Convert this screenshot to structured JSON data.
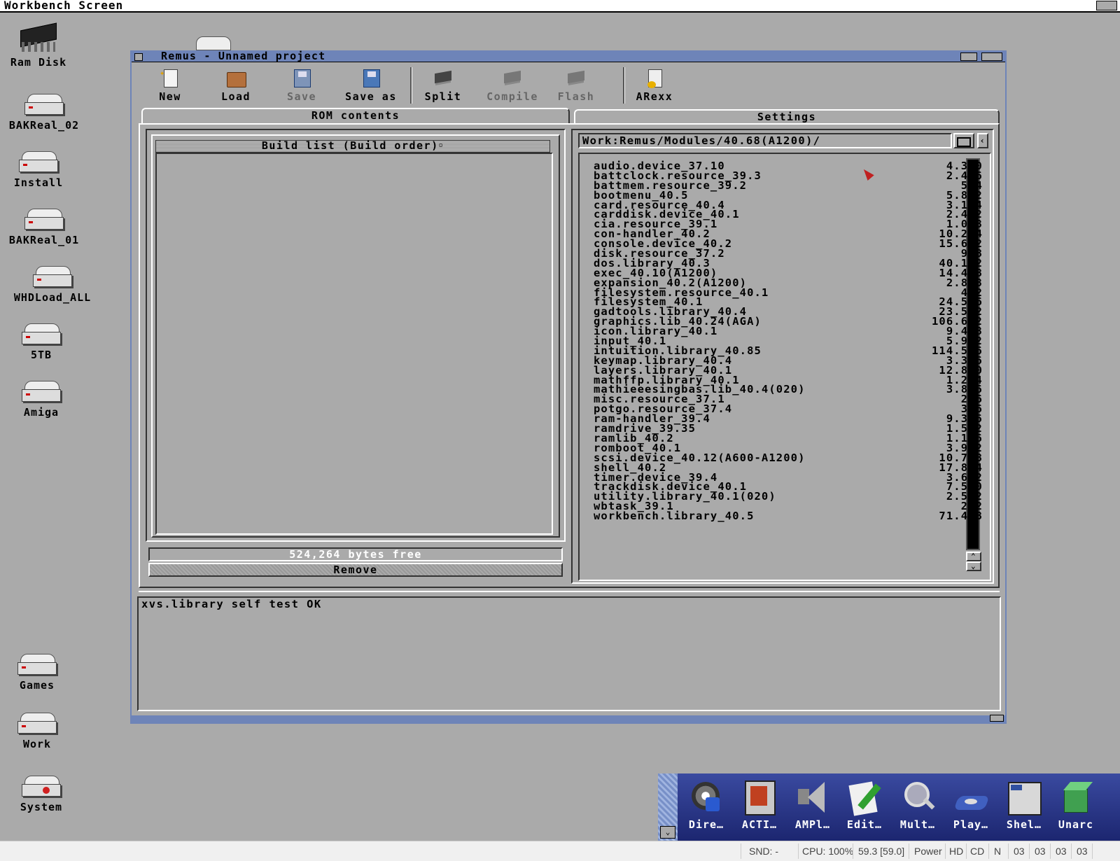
{
  "screen": {
    "title": "Workbench Screen"
  },
  "desktop_icons": [
    {
      "label": "Ram Disk",
      "type": "chip"
    },
    {
      "label": "BAKReal_02",
      "type": "drive"
    },
    {
      "label": "Install",
      "type": "drive"
    },
    {
      "label": "BAKReal_01",
      "type": "drive"
    },
    {
      "label": "WHDLoad_ALL",
      "type": "drive"
    },
    {
      "label": "5TB",
      "type": "drive"
    },
    {
      "label": "Amiga",
      "type": "drive"
    },
    {
      "label": "Games",
      "type": "drive"
    },
    {
      "label": "Work",
      "type": "drive"
    },
    {
      "label": "System",
      "type": "drive"
    }
  ],
  "window": {
    "title": "Remus - Unnamed project",
    "toolbar": {
      "new": "New",
      "load": "Load",
      "save": "Save",
      "save_as": "Save as",
      "split": "Split",
      "compile": "Compile",
      "flash": "Flash",
      "arexx": "ARexx"
    },
    "tabs": {
      "rom_contents": "ROM contents",
      "settings": "Settings"
    },
    "build_list": {
      "header": "Build list (Build order)",
      "bytes_free": "524,264 bytes free",
      "remove": "Remove"
    },
    "path": "Work:Remus/Modules/40.68(A1200)/",
    "modules": [
      {
        "name": "audio.device_37.10",
        "size": "4.360"
      },
      {
        "name": "battclock.resource_39.3",
        "size": "2.476"
      },
      {
        "name": "battmem.resource_39.2",
        "size": "544"
      },
      {
        "name": "bootmenu_40.5",
        "size": "5.812"
      },
      {
        "name": "card.resource_40.4",
        "size": "3.124"
      },
      {
        "name": "carddisk.device_40.1",
        "size": "2.432"
      },
      {
        "name": "cia.resource_39.1",
        "size": "1.068"
      },
      {
        "name": "con-handler_40.2",
        "size": "10.284"
      },
      {
        "name": "console.device_40.2",
        "size": "15.612"
      },
      {
        "name": "disk.resource_37.2",
        "size": "908"
      },
      {
        "name": "dos.library_40.3",
        "size": "40.132"
      },
      {
        "name": "exec_40.10(A1200)",
        "size": "14.428"
      },
      {
        "name": "expansion_40.2(A1200)",
        "size": "2.848"
      },
      {
        "name": "filesystem.resource_40.1",
        "size": "472"
      },
      {
        "name": "filesystem_40.1",
        "size": "24.536"
      },
      {
        "name": "gadtools.library_40.4",
        "size": "23.572"
      },
      {
        "name": "graphics.lib_40.24(AGA)",
        "size": "106.652"
      },
      {
        "name": "icon.library_40.1",
        "size": "9.448"
      },
      {
        "name": "input_40.1",
        "size": "5.932"
      },
      {
        "name": "intuition.library_40.85",
        "size": "114.536"
      },
      {
        "name": "keymap.library_40.4",
        "size": "3.376"
      },
      {
        "name": "layers.library_40.1",
        "size": "12.800"
      },
      {
        "name": "mathffp.library_40.1",
        "size": "1.244"
      },
      {
        "name": "mathieeesingbas.lib_40.4(020)",
        "size": "3.816"
      },
      {
        "name": "misc.resource_37.1",
        "size": "236"
      },
      {
        "name": "potgo.resource_37.4",
        "size": "376"
      },
      {
        "name": "ram-handler_39.4",
        "size": "9.396"
      },
      {
        "name": "ramdrive_39.35",
        "size": "1.592"
      },
      {
        "name": "ramlib_40.2",
        "size": "1.116"
      },
      {
        "name": "romboot_40.1",
        "size": "3.932"
      },
      {
        "name": "scsi.device_40.12(A600-A1200)",
        "size": "10.708"
      },
      {
        "name": "shell_40.2",
        "size": "17.844"
      },
      {
        "name": "timer.device_39.4",
        "size": "3.692"
      },
      {
        "name": "trackdisk.device_40.1",
        "size": "7.520"
      },
      {
        "name": "utility.library_40.1(020)",
        "size": "2.552"
      },
      {
        "name": "wbtask_39.1",
        "size": "252"
      },
      {
        "name": "workbench.library_40.5",
        "size": "71.408"
      }
    ],
    "log": "xvs.library self test OK"
  },
  "dock": {
    "items": [
      {
        "label": "Dire…",
        "icon": "directory-opus-icon",
        "color": "#c8c8d8"
      },
      {
        "label": "ACTI…",
        "icon": "activity-icon",
        "color": "#d0a040"
      },
      {
        "label": "AMPl…",
        "icon": "speaker-icon",
        "color": "#b0b0c0"
      },
      {
        "label": "Edit…",
        "icon": "pencil-icon",
        "color": "#40a040"
      },
      {
        "label": "Mult…",
        "icon": "magnifier-icon",
        "color": "#d0d0e0"
      },
      {
        "label": "Play…",
        "icon": "player-icon",
        "color": "#4060c0"
      },
      {
        "label": "Shel…",
        "icon": "shell-icon",
        "color": "#dcdcdc"
      },
      {
        "label": "Unarc",
        "icon": "archive-cube-icon",
        "color": "#40a050"
      }
    ]
  },
  "status": {
    "snd": "SND: -",
    "cpu": "CPU: 100%",
    "fps": "59.3 [59.0]",
    "power": "Power",
    "hd": "HD",
    "cd": "CD",
    "n": "N",
    "df0": "03",
    "df1": "03",
    "df2": "03",
    "df3": "03"
  }
}
